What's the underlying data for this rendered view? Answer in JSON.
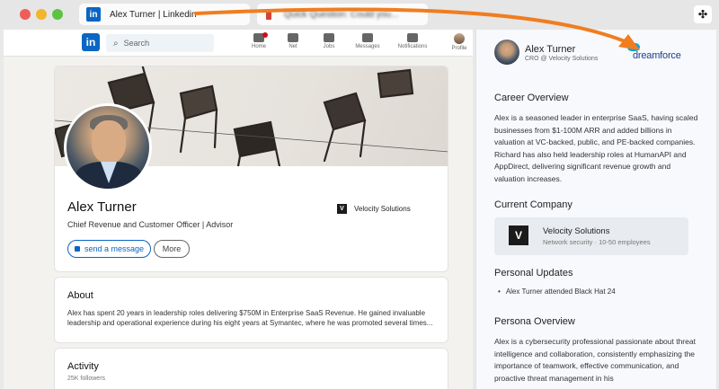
{
  "browser": {
    "tab_active_title": "Alex Turner | Linkedin",
    "tab_inactive_title": "Quick Question: Could you...",
    "tab_active_icon": "in",
    "extension_icon": "puzzle-icon"
  },
  "linkedin": {
    "logo": "in",
    "search_placeholder": "Search",
    "nav": [
      "Home",
      "Net",
      "Jobs",
      "Messages",
      "Notifications",
      "Profile"
    ],
    "profile": {
      "name": "Alex Turner",
      "headline": "Chief Revenue and Customer Officer | Advisor",
      "company": "Velocity Solutions",
      "company_logo": "V",
      "message_button": "send a message",
      "more_button": "More"
    },
    "about": {
      "heading": "About",
      "text": "Alex has spent 20 years in leadership roles delivering $750M in Enterprise SaaS Revenue. He gained invaluable leadership and operational experience during his eight years at Symantec, where he was promoted several times..."
    },
    "activity": {
      "heading": "Activity",
      "followers": "25K followers"
    }
  },
  "panel": {
    "name": "Alex Turner",
    "role": "CRO @ Velocity Solutions",
    "brand": "dreamforce",
    "career_heading": "Career Overview",
    "career_text": "Alex is a seasoned leader in enterprise SaaS, having scaled businesses from $1-100M ARR and added billions in valuation at VC-backed, public, and PE-backed companies. Richard has also held leadership roles at HumanAPI and AppDirect, delivering significant revenue growth and valuation increases.",
    "company_heading": "Current Company",
    "company_name": "Velocity Solutions",
    "company_sub": "Network security · 10-50 employees",
    "company_logo": "V",
    "updates_heading": "Personal Updates",
    "updates": [
      "Alex Turner attended Black Hat 24"
    ],
    "persona_heading": "Persona Overview",
    "persona_text": "Alex is a cybersecurity professional passionate about threat intelligence and collaboration, consistently emphasizing the importance of teamwork, effective communication, and proactive threat management in his"
  },
  "colors": {
    "linkedin_blue": "#0a66c2",
    "arrow_orange": "#f07d1f",
    "dreamforce_blue": "#1b3f8f"
  }
}
